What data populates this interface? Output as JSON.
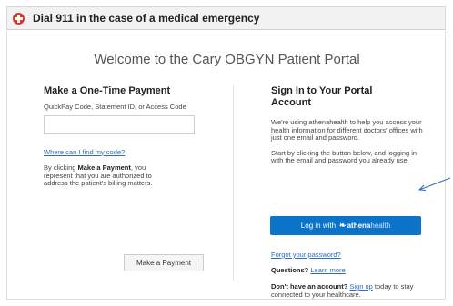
{
  "alert": {
    "text": "Dial 911 in the case of a medical emergency",
    "icon": "medical-cross-icon",
    "icon_color": "#d9352b"
  },
  "header": {
    "welcome": "Welcome to the Cary OBGYN Patient Portal"
  },
  "payment": {
    "heading": "Make a One-Time Payment",
    "code_label": "QuickPay Code, Statement ID, or Access Code",
    "code_value": "",
    "find_code_link": "Where can I find my code?",
    "disclaimer_prefix": "By clicking ",
    "disclaimer_bold": "Make a Payment",
    "disclaimer_suffix": ", you represent that you are authorized to address the patient's billing matters.",
    "button_label": "Make a Payment"
  },
  "signin": {
    "heading": "Sign In to Your Portal Account",
    "intro": "We're using athenahealth to help you access your health information for different doctors' offices with just one email and password.",
    "instructions": "Start by clicking the button below, and logging in with the email and password you already use.",
    "button_prefix": "Log in with",
    "button_brand": "athena",
    "button_brand_suffix": "health",
    "accent_color": "#0b73c8",
    "forgot_link": "Forgot your password?",
    "questions_label": "Questions?",
    "learn_more_link": "Learn more",
    "no_account_label": "Don't have an account?",
    "sign_up_link": "Sign up",
    "no_account_suffix": " today to stay connected to your healthcare."
  },
  "annotation": {
    "arrow_color": "#2a6ebb"
  }
}
